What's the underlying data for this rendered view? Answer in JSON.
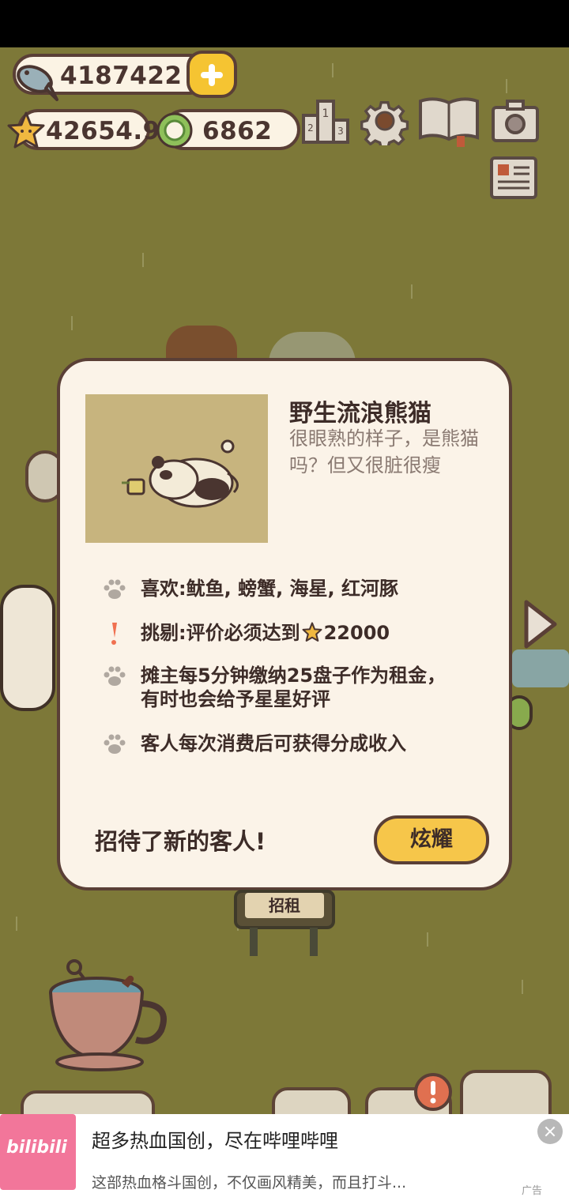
{
  "currency": {
    "fish": "4187422",
    "stars": "42654.9",
    "coins": "6862"
  },
  "icons": {
    "fish": "fish-icon",
    "add": "plus-icon",
    "star": "star-icon",
    "coin": "coin-icon",
    "ranking": "ranking-podium-icon",
    "settings": "gear-icon",
    "collection": "book-icon",
    "camera": "camera-icon",
    "news": "newspaper-icon",
    "next": "arrow-right-icon"
  },
  "customer": {
    "name": "野生流浪熊猫",
    "description": "很眼熟的样子，是熊猫吗？但又很脏很瘦",
    "traits": [
      {
        "icon": "paw-icon",
        "text": "喜欢:鱿鱼, 螃蟹, 海星, 红河豚"
      },
      {
        "icon": "exclamation-icon",
        "text": "挑剔:评价必须达到",
        "value": "22000"
      },
      {
        "icon": "paw-icon",
        "text": "摊主每5分钟缴纳25盘子作为租金，",
        "text2": "有时也会给予星星好评"
      },
      {
        "icon": "paw-icon",
        "text": "客人每次消费后可获得分成收入"
      }
    ]
  },
  "modal": {
    "welcome": "招待了新的客人!",
    "show_button": "炫耀"
  },
  "sign": {
    "label": "招租"
  },
  "ad": {
    "logo": "bilibili",
    "title": "超多热血国创，尽在哔哩哔哩",
    "subtitle": "这部热血格斗国创，不仅画风精美，而且打斗...",
    "tag": "广告"
  },
  "colors": {
    "background": "#7d7838",
    "panel": "#fbf3e8",
    "border": "#5a3f36",
    "button": "#f6c64a",
    "accent_red": "#f07050"
  }
}
